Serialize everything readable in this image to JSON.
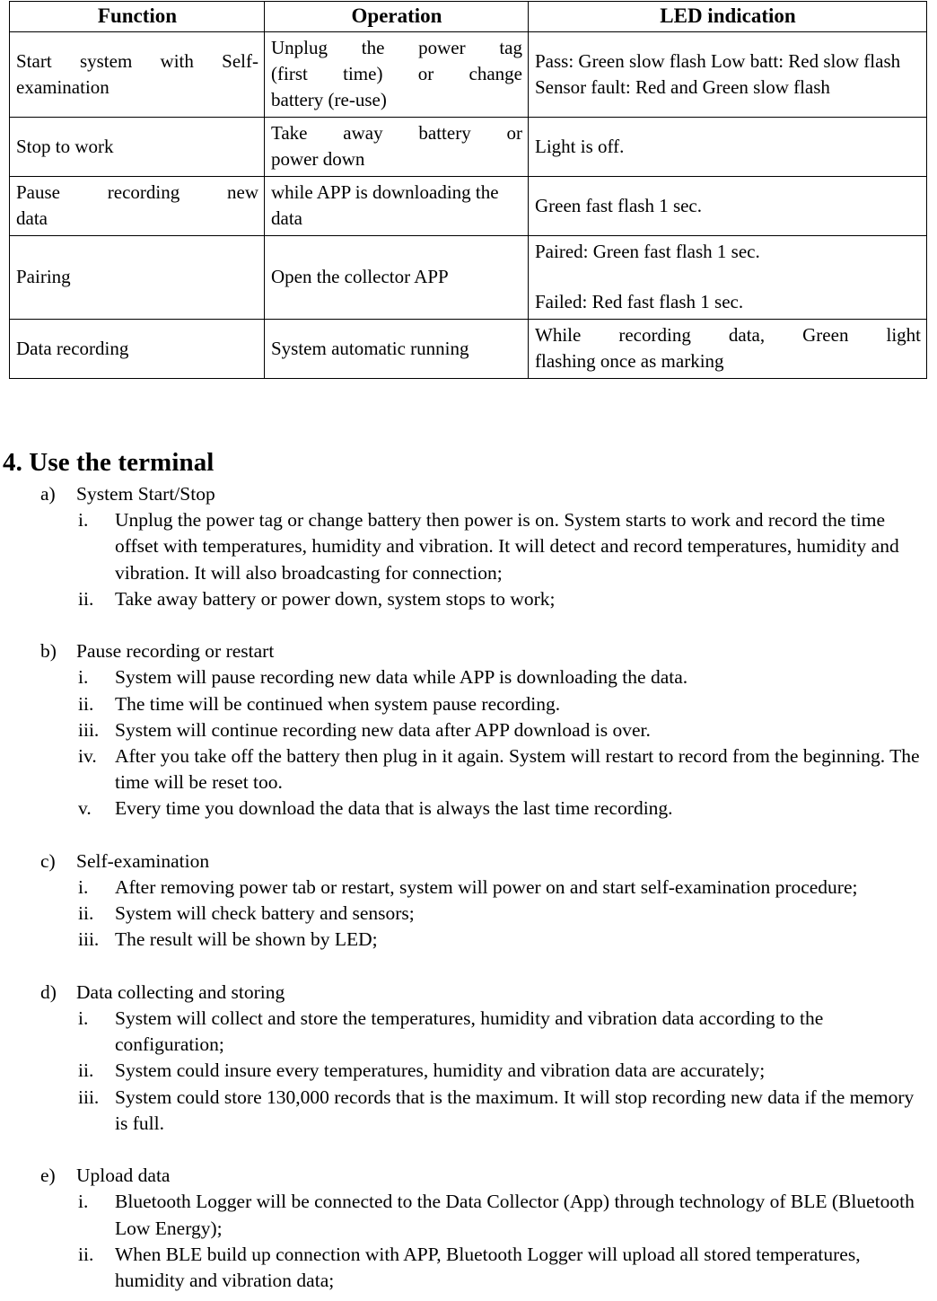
{
  "table": {
    "headers": [
      "Function",
      "Operation",
      "LED indication"
    ],
    "rows": [
      {
        "function": "Start system with Self-examination",
        "function_lines": [
          "Start   system  with  Self-",
          "examination"
        ],
        "operation_lines": [
          "Unplug   the   power   tag",
          "(first   time)   or   change",
          "battery (re-use)"
        ],
        "led_lines": [
          "Pass:  Green slow flash",
          "Low batt:  Red slow flash",
          "Sensor fault: Red and Green slow flash"
        ]
      },
      {
        "function": "Stop to work",
        "function_lines": [
          "Stop to work"
        ],
        "operation_lines": [
          "Take   away   battery   or",
          "power down"
        ],
        "led_lines": [
          "Light is off."
        ]
      },
      {
        "function": "Pause recording new data",
        "function_lines": [
          "Pause    recording    new",
          "data"
        ],
        "operation_lines": [
          "while APP is downloading",
          "the data"
        ],
        "led_lines": [
          "Green fast flash 1 sec."
        ]
      },
      {
        "function": "Pairing",
        "function_lines": [
          "Pairing"
        ],
        "operation_lines": [
          "Open the collector APP"
        ],
        "led_lines": [
          "Paired:  Green fast flash 1 sec.",
          "",
          "Failed:  Red fast flash 1 sec."
        ]
      },
      {
        "function": "Data recording",
        "function_lines": [
          "Data recording"
        ],
        "operation_lines": [
          "System automatic running"
        ],
        "led_lines": [
          "While    recording    data,    Green    light",
          "flashing once as marking"
        ]
      }
    ]
  },
  "heading": "4. Use the terminal",
  "sections": [
    {
      "marker": "a)",
      "title": "System Start/Stop",
      "items": [
        {
          "marker": "i.",
          "text": "Unplug the power tag or change battery then power is on. System starts to work and record the time offset with temperatures,  humidity and vibration.  It will detect and record temperatures,  humidity and vibration. It will also broadcasting for connection;"
        },
        {
          "marker": "ii.",
          "text": "Take away battery or power down, system stops to work;"
        }
      ]
    },
    {
      "marker": "b)",
      "title": "Pause  recording or restart",
      "items": [
        {
          "marker": "i.",
          "text": "System will pause recording new data while APP is downloading the data."
        },
        {
          "marker": "ii.",
          "text": "The time will be continued when system pause recording."
        },
        {
          "marker": "iii.",
          "text": "System will continue recording new data after APP download is over."
        },
        {
          "marker": "iv.",
          "text": "After you take off the battery  then plug in it again. System will restart to record from the beginning. The time will be reset too."
        },
        {
          "marker": "v.",
          "text": "Every time you download the data that is always the last time recording."
        }
      ]
    },
    {
      "marker": "c)",
      "title": "Self-examination",
      "items": [
        {
          "marker": "i.",
          "text": "After removing power tab or restart, system will power on and start self-examination procedure;"
        },
        {
          "marker": "ii.",
          "text": "System will check battery and sensors;"
        },
        {
          "marker": "iii.",
          "text": "The result will be shown by LED;"
        }
      ]
    },
    {
      "marker": "d)",
      "title": "Data collecting and storing",
      "items": [
        {
          "marker": "i.",
          "text": "System will collect and store the temperatures,  humidity and vibration data according to the configuration;"
        },
        {
          "marker": "ii.",
          "text": "System could insure every  temperatures,  humidity and vibration data are accurately;"
        },
        {
          "marker": "iii.",
          "text": "System could store 130,000 records that is the maximum. It will stop recording new data if the memory is full."
        }
      ]
    },
    {
      "marker": "e)",
      "title": "Upload data",
      "items": [
        {
          "marker": "i.",
          "text": "Bluetooth Logger will be connected to the Data Collector (App) through technology of BLE (Bluetooth Low Energy);"
        },
        {
          "marker": "ii.",
          "text": "When BLE build up connection with APP, Bluetooth Logger will upload all stored temperatures,  humidity and vibration data;"
        }
      ]
    }
  ]
}
